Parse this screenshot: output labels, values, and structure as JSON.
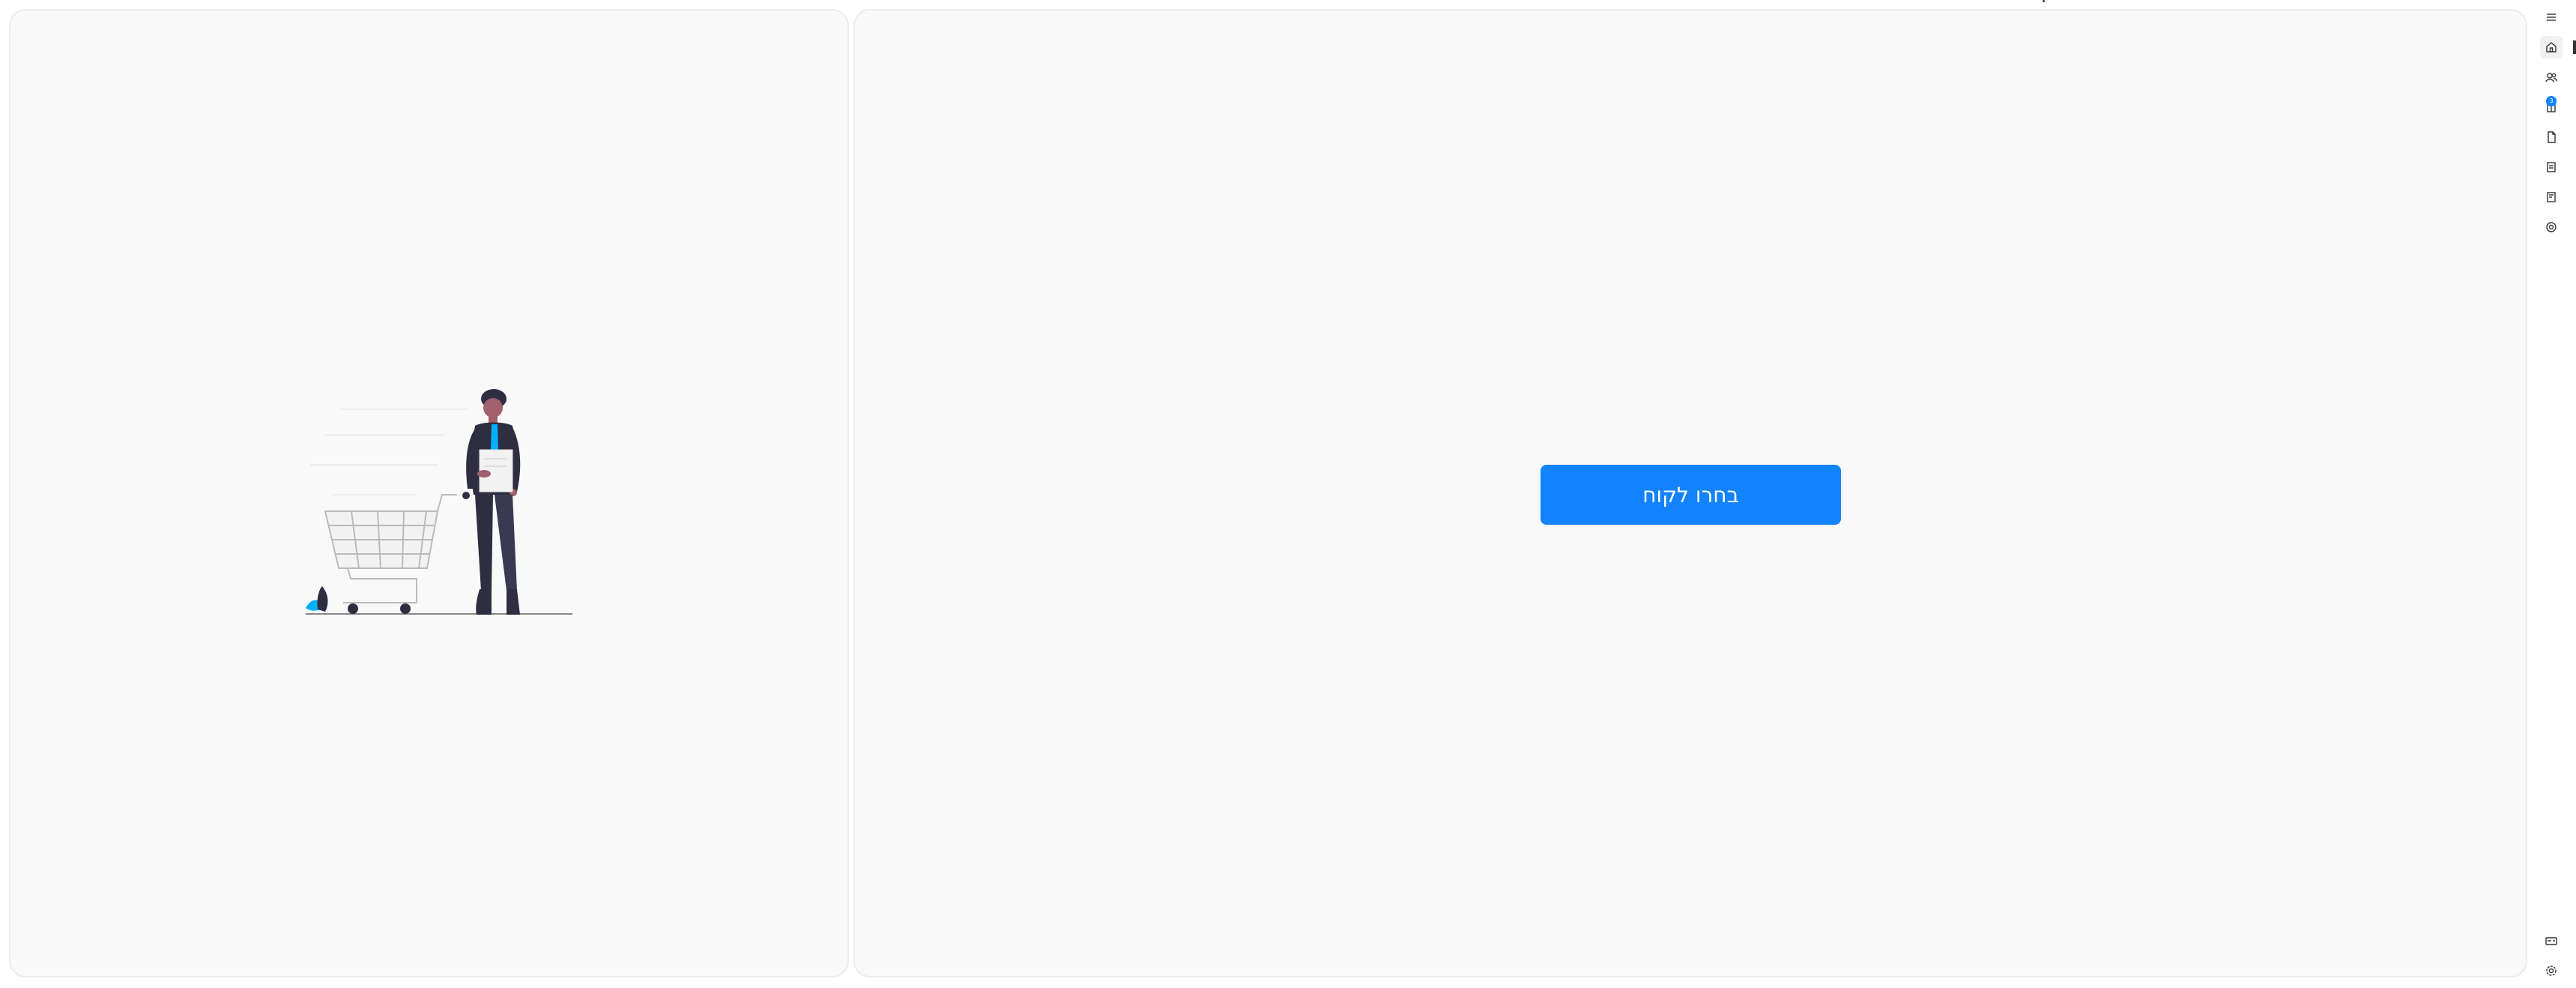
{
  "main": {
    "select_customer_label": "בחרו לקוח"
  },
  "sidebar": {
    "items": [
      {
        "icon": "menu-icon"
      },
      {
        "icon": "home-icon",
        "active": true
      },
      {
        "icon": "users-icon"
      },
      {
        "icon": "book-icon",
        "badge": "3"
      },
      {
        "icon": "document-icon"
      },
      {
        "icon": "receipt-icon"
      },
      {
        "icon": "receipt-alt-icon"
      },
      {
        "icon": "support-icon"
      }
    ],
    "bottom_items": [
      {
        "icon": "card-icon"
      },
      {
        "icon": "settings-icon"
      }
    ]
  },
  "colors": {
    "accent": "#1283fc",
    "panel_bg": "#f9f9f9",
    "panel_border": "#ececec",
    "figure_dark": "#2f2e41",
    "figure_accent": "#00b0ff"
  }
}
